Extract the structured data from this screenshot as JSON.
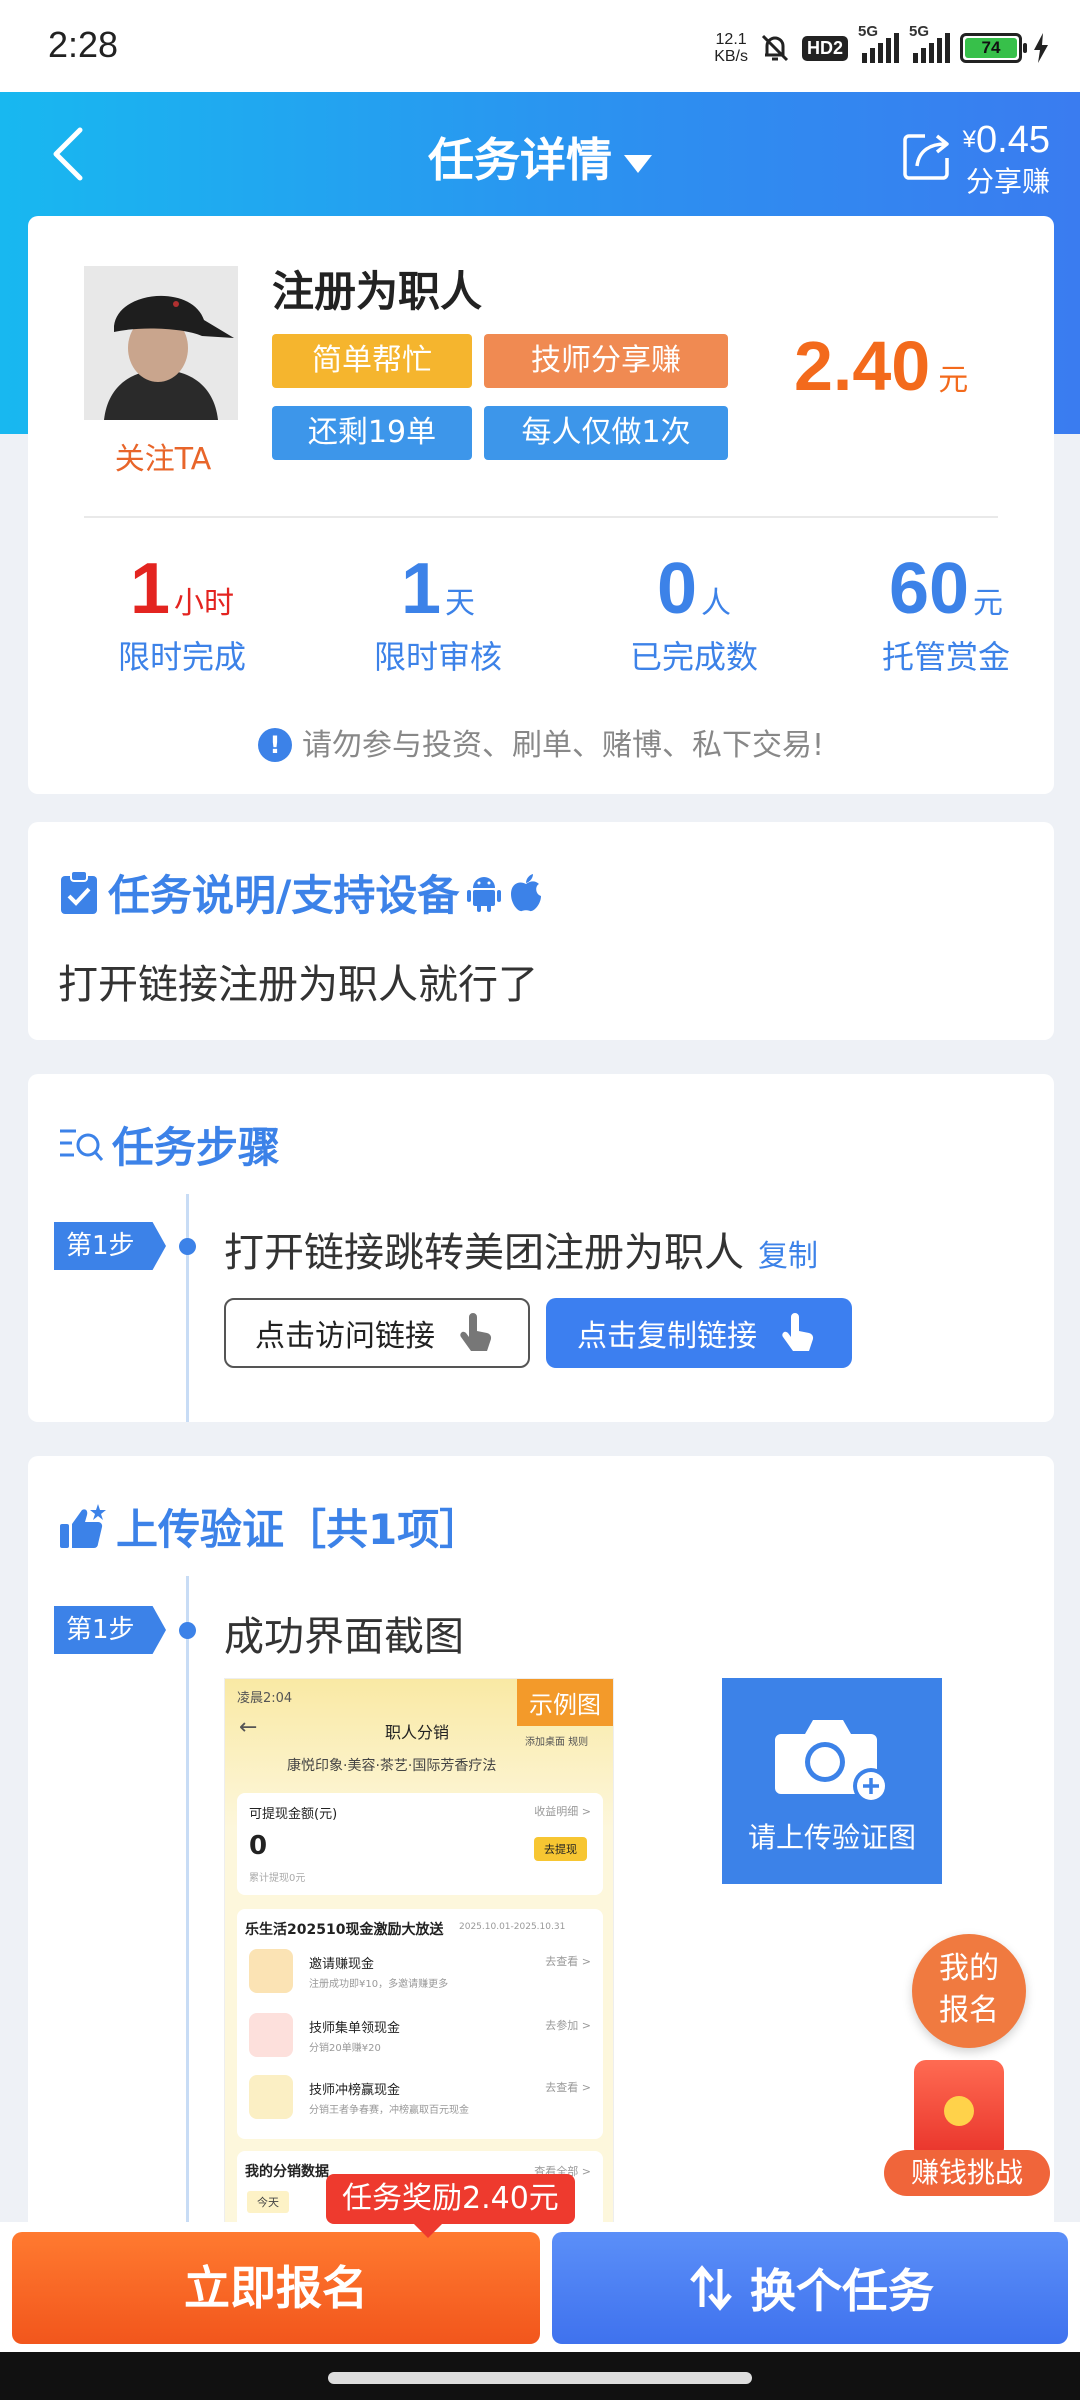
{
  "status_bar": {
    "time": "2:28",
    "net_speed_value": "12.1",
    "net_speed_unit": "KB/s",
    "hd": "HD2",
    "sig1": "5G",
    "sig2": "5G",
    "battery": "74"
  },
  "nav": {
    "title": "任务详情",
    "share_currency": "¥",
    "share_amount": "0.45",
    "share_label": "分享赚"
  },
  "task": {
    "name": "注册为职人",
    "follow_label": "关注TA",
    "tags": [
      "简单帮忙",
      "技师分享赚",
      "还剩19单",
      "每人仅做1次"
    ],
    "price": "2.40",
    "price_unit": "元",
    "stats": [
      {
        "num": "1",
        "unit": "小时",
        "label": "限时完成"
      },
      {
        "num": "1",
        "unit": "天",
        "label": "限时审核"
      },
      {
        "num": "0",
        "unit": "人",
        "label": "已完成数"
      },
      {
        "num": "60",
        "unit": "元",
        "label": "托管赏金"
      }
    ],
    "warning": "请勿参与投资、刷单、赌博、私下交易!"
  },
  "description": {
    "title": "任务说明/支持设备",
    "text": "打开链接注册为职人就行了"
  },
  "steps": {
    "title": "任务步骤",
    "badge": "第1步",
    "step1_text": "打开链接跳转美团注册为职人",
    "copy_label": "复制",
    "visit_button": "点击访问链接",
    "copy_button": "点击复制链接"
  },
  "upload": {
    "title": "上传验证［共1项］",
    "badge": "第1步",
    "item_text": "成功界面截图",
    "example_label": "示例图",
    "upload_label": "请上传验证图"
  },
  "screenshot": {
    "time": "凌晨2:04",
    "title": "职人分销",
    "links": "添加桌面  规则",
    "shop": "康悦印象·美容·茶艺·国际芳香疗法",
    "withdraw_label": "可提现金额(元)",
    "income_link": "收益明细 >",
    "amount": "0",
    "cumulative": "累计提现0元",
    "withdraw_btn": "去提现",
    "promo_title": "乐生活202510现金激励大放送",
    "promo_date": "2025.10.01-2025.10.31",
    "rows": [
      {
        "name": "邀请赚现金",
        "sub": "注册成功即¥10，多邀请赚更多",
        "link": "去查看 >"
      },
      {
        "name": "技师集单领现金",
        "sub": "分销20单赚¥20",
        "link": "去参加 >"
      },
      {
        "name": "技师冲榜赢现金",
        "sub": "分销王者争春赛，冲榜赢取百元现金",
        "link": "去查看 >"
      }
    ],
    "my_data": "我的分销数据",
    "view_all": "查看全部 >",
    "today": "今天"
  },
  "floating": {
    "enroll_line1": "我的",
    "enroll_line2": "报名",
    "challenge": "赚钱挑战"
  },
  "bottom": {
    "reward_tip": "任务奖励2.40元",
    "enroll_button": "立即报名",
    "switch_button": "换个任务"
  }
}
